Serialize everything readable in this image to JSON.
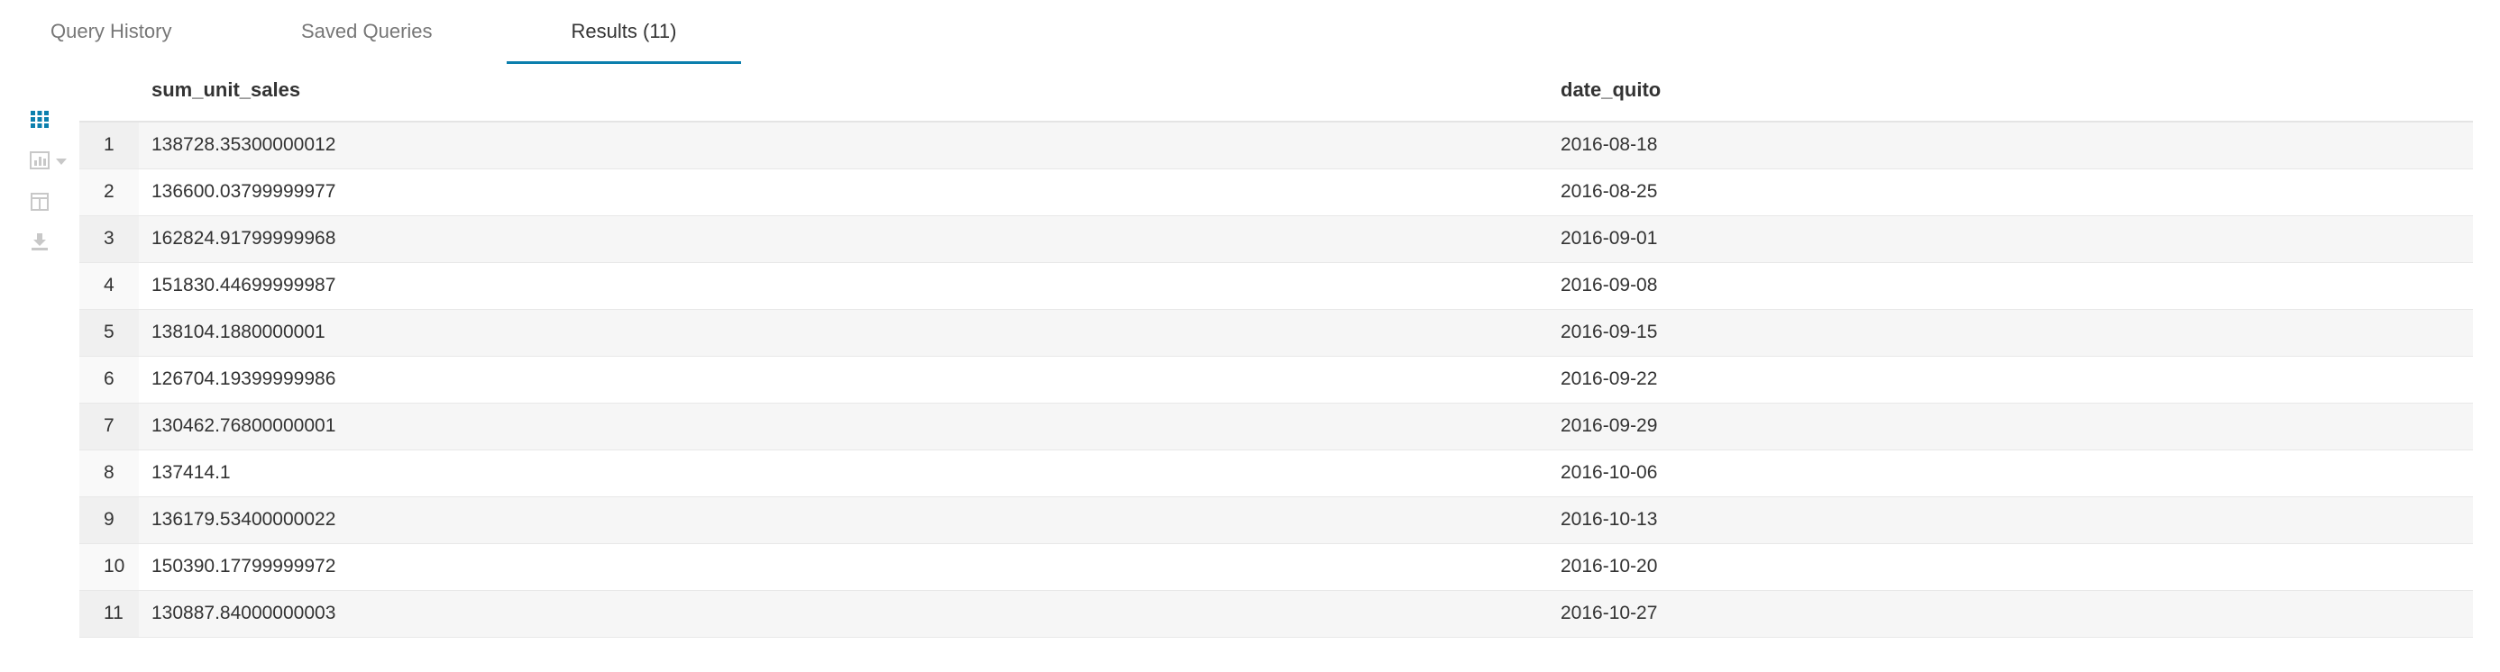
{
  "tabs": [
    {
      "label": "Query History",
      "active": false
    },
    {
      "label": "Saved Queries",
      "active": false
    },
    {
      "label": "Results (11)",
      "active": true
    }
  ],
  "rail": {
    "icons": [
      "grid-icon",
      "chart-icon",
      "columns-icon",
      "download-icon"
    ],
    "active_color": "#0b7fad",
    "inactive_color": "#c8c8c8"
  },
  "table": {
    "columns": [
      "sum_unit_sales",
      "date_quito"
    ],
    "rows": [
      {
        "num": "1",
        "sum_unit_sales": "138728.35300000012",
        "date_quito": "2016-08-18"
      },
      {
        "num": "2",
        "sum_unit_sales": "136600.03799999977",
        "date_quito": "2016-08-25"
      },
      {
        "num": "3",
        "sum_unit_sales": "162824.91799999968",
        "date_quito": "2016-09-01"
      },
      {
        "num": "4",
        "sum_unit_sales": "151830.44699999987",
        "date_quito": "2016-09-08"
      },
      {
        "num": "5",
        "sum_unit_sales": "138104.1880000001",
        "date_quito": "2016-09-15"
      },
      {
        "num": "6",
        "sum_unit_sales": "126704.19399999986",
        "date_quito": "2016-09-22"
      },
      {
        "num": "7",
        "sum_unit_sales": "130462.76800000001",
        "date_quito": "2016-09-29"
      },
      {
        "num": "8",
        "sum_unit_sales": "137414.1",
        "date_quito": "2016-10-06"
      },
      {
        "num": "9",
        "sum_unit_sales": "136179.53400000022",
        "date_quito": "2016-10-13"
      },
      {
        "num": "10",
        "sum_unit_sales": "150390.17799999972",
        "date_quito": "2016-10-20"
      },
      {
        "num": "11",
        "sum_unit_sales": "130887.84000000003",
        "date_quito": "2016-10-27"
      }
    ]
  },
  "colors": {
    "accent": "#0b7fad",
    "row_alt": "#f6f6f6"
  }
}
